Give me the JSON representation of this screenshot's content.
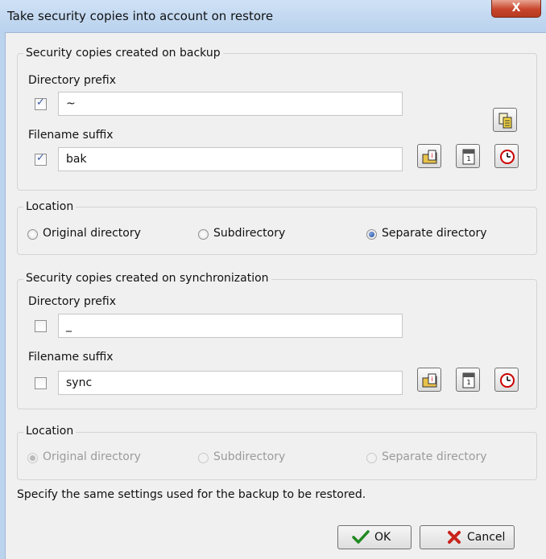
{
  "window": {
    "title": "Take security copies into account on restore",
    "close_label": "X"
  },
  "backup_group": {
    "legend": "Security copies created on backup",
    "directory_prefix_label": "Directory prefix",
    "directory_prefix_checked": true,
    "directory_prefix_value": "~",
    "filename_suffix_label": "Filename suffix",
    "filename_suffix_checked": true,
    "filename_suffix_value": "bak"
  },
  "backup_location": {
    "legend": "Location",
    "options": [
      "Original directory",
      "Subdirectory",
      "Separate directory"
    ],
    "selected": "Separate directory"
  },
  "sync_group": {
    "legend": "Security copies created on synchronization",
    "directory_prefix_label": "Directory prefix",
    "directory_prefix_checked": false,
    "directory_prefix_value": "_",
    "filename_suffix_label": "Filename suffix",
    "filename_suffix_checked": false,
    "filename_suffix_value": "sync"
  },
  "sync_location": {
    "legend": "Location",
    "options": [
      "Original directory",
      "Subdirectory",
      "Separate directory"
    ],
    "selected": "Original directory",
    "disabled": true
  },
  "hint": "Specify the same settings used for the backup to be restored.",
  "buttons": {
    "ok": "OK",
    "cancel": "Cancel"
  },
  "icons": [
    "copy-icon",
    "folder-info-icon",
    "calendar-icon",
    "clock-icon"
  ]
}
